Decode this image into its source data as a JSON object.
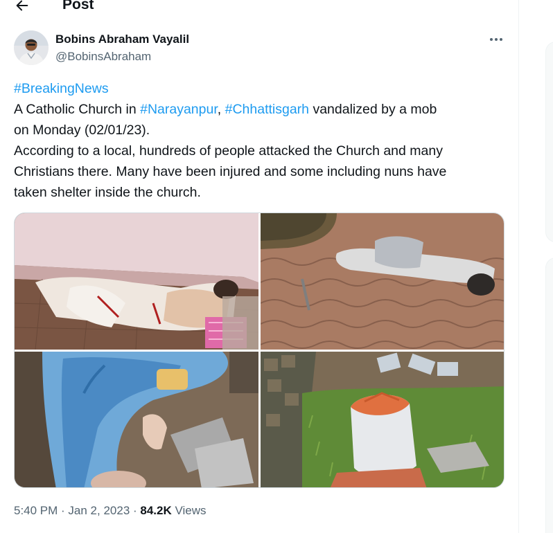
{
  "header": {
    "title": "Post",
    "back_icon": "arrow-left-icon"
  },
  "author": {
    "name": "Bobins Abraham Vayalil",
    "handle": "@BobinsAbraham",
    "more_icon": "more-horizontal-icon"
  },
  "tweet": {
    "line1_tag": "#BreakingNews",
    "line2_pre": "A Catholic Church in ",
    "line2_tag1": "#Narayanpur",
    "line2_sep": ", ",
    "line2_tag2": "#Chhattisgarh",
    "line2_post": " vandalized by a mob",
    "line3": "on Monday (02/01/23).",
    "line4": "According to a local, hundreds of people attacked the Church and many",
    "line5": "Christians there. Many have been injured and some including nuns have",
    "line6": "taken shelter inside the church."
  },
  "media": {
    "images": [
      "photo-statue-on-floor",
      "photo-statue-on-paving",
      "photo-broken-blue-statue",
      "photo-broken-statue-base-on-grass"
    ]
  },
  "meta": {
    "time": "5:40 PM",
    "sep1": " · ",
    "date": "Jan 2, 2023",
    "sep2": " · ",
    "views_count": "84.2K",
    "views_label": " Views"
  },
  "colors": {
    "link": "#1d9bf0",
    "text": "#0f1419",
    "secondary": "#536471",
    "border": "#cfd9de"
  }
}
